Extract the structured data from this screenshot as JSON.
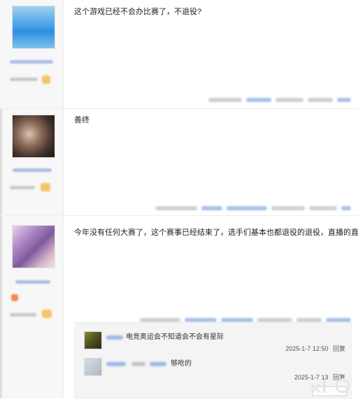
{
  "posts": [
    {
      "content": "这个游戏已经不会办比赛了，不退役?"
    },
    {
      "content": "善终"
    },
    {
      "content": "今年没有任何大赛了，这个赛事已经结束了，选手们基本也都退役的退役，直播的直播吧"
    }
  ],
  "replies": [
    {
      "text": "电竞奥运会不知道会不会有星际",
      "time": "2025-1-7 12:50",
      "action": "回复"
    },
    {
      "text": "够呛的",
      "time": "2025-1-7 13",
      "action": "回复"
    }
  ],
  "colors": {
    "link_blue": "#3b6cc8",
    "sidebar_bg": "#f7f7f7",
    "reply_bg": "#f4f4f4"
  }
}
